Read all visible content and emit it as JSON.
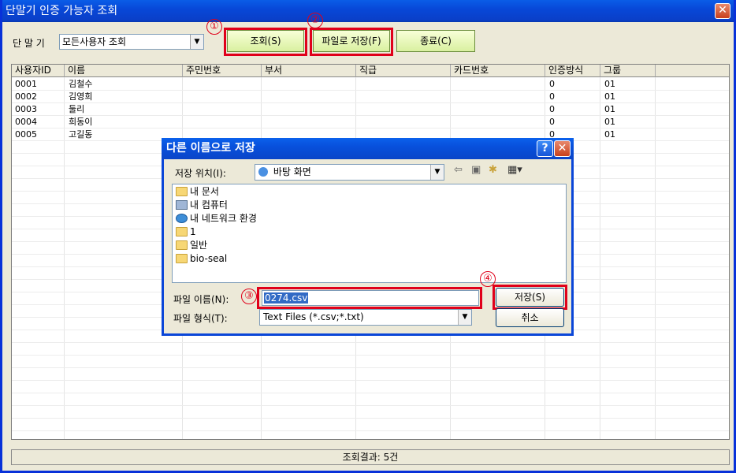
{
  "window": {
    "title": "단말기 인증 가능자 조회",
    "close_glyph": "✕"
  },
  "toolbar": {
    "terminal_label": "단 말 기",
    "terminal_select_value": "모든사용자 조회",
    "query_button": "조회(S)",
    "save_file_button": "파일로 저장(F)",
    "exit_button": "종료(C)"
  },
  "annotations": [
    "①",
    "②",
    "③",
    "④"
  ],
  "table": {
    "columns": [
      "사용자ID",
      "이름",
      "주민번호",
      "부서",
      "직급",
      "카드번호",
      "인증방식",
      "그룹"
    ],
    "rows": [
      [
        "0001",
        "김철수",
        "",
        "",
        "",
        "",
        "0",
        "01"
      ],
      [
        "0002",
        "김영희",
        "",
        "",
        "",
        "",
        "0",
        "01"
      ],
      [
        "0003",
        "둘리",
        "",
        "",
        "",
        "",
        "0",
        "01"
      ],
      [
        "0004",
        "희동이",
        "",
        "",
        "",
        "",
        "0",
        "01"
      ],
      [
        "0005",
        "고길동",
        "",
        "",
        "",
        "",
        "0",
        "01"
      ]
    ]
  },
  "status": {
    "text": "조회결과: 5건"
  },
  "dialog": {
    "title": "다른 이름으로 저장",
    "help_glyph": "?",
    "close_glyph": "✕",
    "location_label": "저장 위치(I):",
    "location_value": "바탕 화면",
    "items": [
      "내 문서",
      "내 컴퓨터",
      "내 네트워크 환경",
      "1",
      "일반",
      "bio-seal"
    ],
    "filename_label": "파일 이름(N):",
    "filename_value": "0274.csv",
    "filetype_label": "파일 형식(T):",
    "filetype_value": "Text Files (*.csv;*.txt)",
    "save_button": "저장(S)",
    "cancel_button": "취소"
  }
}
